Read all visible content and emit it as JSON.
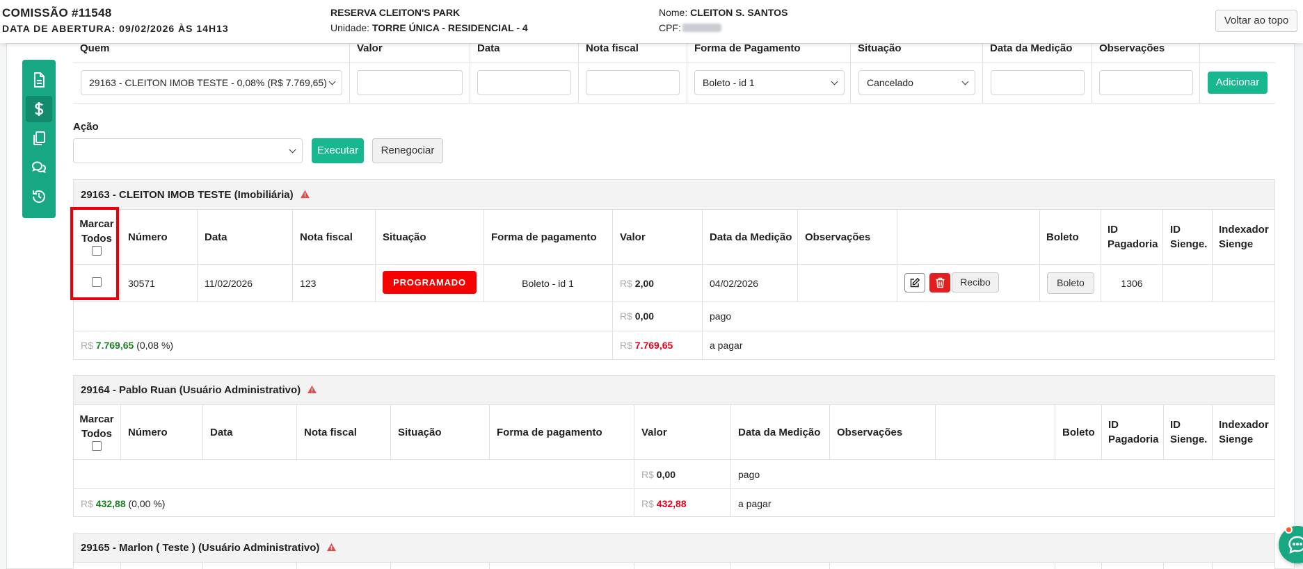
{
  "header": {
    "title": "COMISSÃO #11548",
    "opening_date": "DATA DE ABERTURA: 09/02/2026 ÀS 14H13",
    "reserva": "RESERVA CLEITON'S PARK",
    "unidade_label": "Unidade:",
    "unidade_value": "TORRE ÚNICA - RESIDENCIAL - 4",
    "nome_label": "Nome:",
    "nome_value": "CLEITON S. SANTOS",
    "cpf_label": "CPF:",
    "back_to_top": "Voltar ao topo"
  },
  "sidebar": {
    "items": [
      {
        "icon": "document-icon"
      },
      {
        "icon": "dollar-icon",
        "active": true
      },
      {
        "icon": "copy-icon"
      },
      {
        "icon": "chat-bubbles-icon"
      },
      {
        "icon": "history-icon"
      }
    ]
  },
  "add_form": {
    "headers": [
      "Quem",
      "Valor",
      "Data",
      "Nota fiscal",
      "Forma de Pagamento",
      "Situação",
      "Data da Medição",
      "Observações"
    ],
    "quem_value": "29163 - CLEITON IMOB TESTE - 0,08% (R$ 7.769,65)",
    "forma_value": "Boleto - id 1",
    "situacao_value": "Cancelado",
    "add_button": "Adicionar"
  },
  "acao": {
    "label": "Ação",
    "select_value": "",
    "execute_button": "Executar",
    "renegotiate_button": "Renegociar"
  },
  "table_headers": {
    "marcar": "Marcar Todos",
    "numero": "Número",
    "data": "Data",
    "nota": "Nota fiscal",
    "situacao": "Situação",
    "forma": "Forma de pagamento",
    "valor": "Valor",
    "medicao": "Data da Medição",
    "obs": "Observações",
    "boleto": "Boleto",
    "id_pag": "ID Pagadoria",
    "id_sienge": "ID Sienge.",
    "indexador": "Indexador Sienge"
  },
  "sections": [
    {
      "title": "29163 - CLEITON IMOB TESTE (Imobiliária)",
      "rows": [
        {
          "numero": "30571",
          "data": "11/02/2026",
          "nota": "123",
          "situacao": "PROGRAMADO",
          "forma": "Boleto - id 1",
          "valor_currency": "R$",
          "valor": "2,00",
          "medicao": "04/02/2026",
          "recibo_button": "Recibo",
          "boleto_button": "Boleto",
          "id_pagadoria": "1306"
        }
      ],
      "pago_currency": "R$",
      "pago_value": "0,00",
      "pago_label": "pago",
      "total_currency": "R$",
      "total_value": "7.769,65",
      "total_pct": "(0,08 %)",
      "apagar_currency": "R$",
      "apagar_value": "7.769,65",
      "apagar_label": "a pagar"
    },
    {
      "title": "29164 - Pablo Ruan (Usuário Administrativo)",
      "pago_currency": "R$",
      "pago_value": "0,00",
      "pago_label": "pago",
      "total_currency": "R$",
      "total_value": "432,88",
      "total_pct": "(0,00 %)",
      "apagar_currency": "R$",
      "apagar_value": "432,88",
      "apagar_label": "a pagar"
    },
    {
      "title": "29165 - Marlon ( Teste ) (Usuário Administrativo)"
    }
  ],
  "colors": {
    "accent": "#17a883",
    "badge_red": "#f60000",
    "money_green": "#157f1f",
    "money_red": "#e3001b"
  }
}
